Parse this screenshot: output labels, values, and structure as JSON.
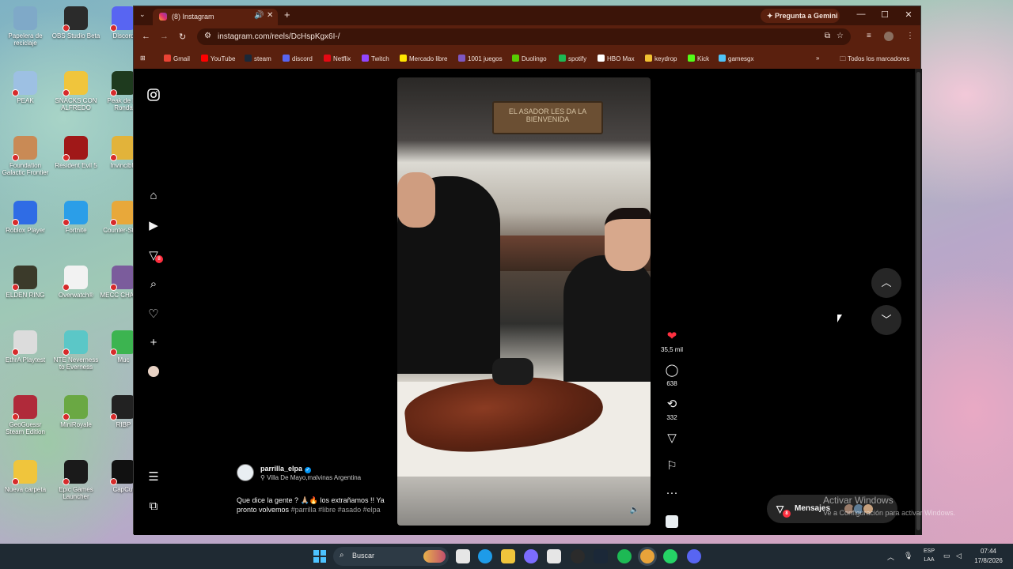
{
  "desktop": {
    "icons": [
      {
        "label": "Papelera de reciclaje",
        "color": "#7fa9c8"
      },
      {
        "label": "OBS Studio Beta",
        "color": "#2b2b2b"
      },
      {
        "label": "Discord",
        "color": "#5865f2"
      },
      {
        "label": "PEAK",
        "color": "#9dc0e3"
      },
      {
        "label": "SNACKS CON ALFREDO",
        "color": "#f0c53c"
      },
      {
        "label": "Peak de Fo Ronda",
        "color": "#1e3a1e"
      },
      {
        "label": "Foundation Galactic Frontier",
        "color": "#c98a55"
      },
      {
        "label": "Resident Evil 5",
        "color": "#a01818"
      },
      {
        "label": "Invincible",
        "color": "#e2b33a"
      },
      {
        "label": "Roblox Player",
        "color": "#2f6ce5"
      },
      {
        "label": "Fortnite",
        "color": "#2b9ee8"
      },
      {
        "label": "Counter-Strike",
        "color": "#e8a83a"
      },
      {
        "label": "ELDEN RING",
        "color": "#3b3a2a"
      },
      {
        "label": "Overwatch®",
        "color": "#f2f2f2"
      },
      {
        "label": "MECC CHAMEL",
        "color": "#7b5c9c"
      },
      {
        "label": "EthrA Playtest",
        "color": "#dcdcdc"
      },
      {
        "label": "NTE Neverness to Everness",
        "color": "#5bc7c7"
      },
      {
        "label": "Muc",
        "color": "#3cb450"
      },
      {
        "label": "GeoGuessr Steam Edition",
        "color": "#b02a3a"
      },
      {
        "label": "MiniRoyale",
        "color": "#6aa843"
      },
      {
        "label": "RIBP",
        "color": "#222222"
      },
      {
        "label": "Nueva carpeta",
        "color": "#f0c53c"
      },
      {
        "label": "Epic Games Launcher",
        "color": "#1a1a1a"
      },
      {
        "label": "CapCut",
        "color": "#111111"
      }
    ]
  },
  "browser": {
    "tab_title": "(8) Instagram",
    "gemini_label": "Pregunta a Gemini",
    "url": "instagram.com/reels/DcHspKgx6I-/",
    "bookmarks": [
      {
        "label": "Gmail",
        "color": "#ea4335"
      },
      {
        "label": "YouTube",
        "color": "#ff0000"
      },
      {
        "label": "steam",
        "color": "#1b2838"
      },
      {
        "label": "discord",
        "color": "#5865f2"
      },
      {
        "label": "Netflix",
        "color": "#e50914"
      },
      {
        "label": "Twitch",
        "color": "#9146ff"
      },
      {
        "label": "Mercado libre",
        "color": "#ffe600"
      },
      {
        "label": "1001 juegos",
        "color": "#7e57c2"
      },
      {
        "label": "Duolingo",
        "color": "#58cc02"
      },
      {
        "label": "spotify",
        "color": "#1db954"
      },
      {
        "label": "HBO Max",
        "color": "#ffffff"
      },
      {
        "label": "keydrop",
        "color": "#f1c232"
      },
      {
        "label": "Kick",
        "color": "#53fc18"
      },
      {
        "label": "gamesgx",
        "color": "#4fc3f7"
      }
    ],
    "all_bookmarks_label": "Todos los marcadores"
  },
  "instagram": {
    "messages_badge": "8",
    "reel": {
      "sign_text": "EL ASADOR LES DA LA BIENVENIDA",
      "likes": "35,5 mil",
      "comments": "638",
      "reposts": "332",
      "username": "parrilla_elpa",
      "location": "Villa De Mayo,malvinas Argentina",
      "caption_text": "Que dice la gente ? 🙏🏼🔥 los extrañamos !! Ya pronto volvemos",
      "caption_tags": "#parrilla #libre #asado #elpa"
    },
    "messages_label": "Mensajes",
    "messages_pill_badge": "8"
  },
  "watermark": {
    "line1": "Activar Windows",
    "line2": "Ve a Configuración para activar Windows."
  },
  "taskbar": {
    "search_placeholder": "Buscar",
    "lang_line1": "ESP",
    "lang_line2": "LAA",
    "time": "07:44",
    "date": "17/8/2026",
    "apps": [
      {
        "name": "task-view",
        "color": "#e6e6e6"
      },
      {
        "name": "edge",
        "color": "#1e9be8"
      },
      {
        "name": "file-explorer",
        "color": "#f0c53c"
      },
      {
        "name": "cortana",
        "color": "#7b6cff"
      },
      {
        "name": "store",
        "color": "#e6e6e6"
      },
      {
        "name": "obs",
        "color": "#2b2b2b"
      },
      {
        "name": "steam",
        "color": "#1b2838"
      },
      {
        "name": "spotify",
        "color": "#1db954"
      },
      {
        "name": "chrome",
        "color": "#e8a33a"
      },
      {
        "name": "whatsapp",
        "color": "#25d366"
      },
      {
        "name": "discord",
        "color": "#5865f2"
      }
    ]
  }
}
